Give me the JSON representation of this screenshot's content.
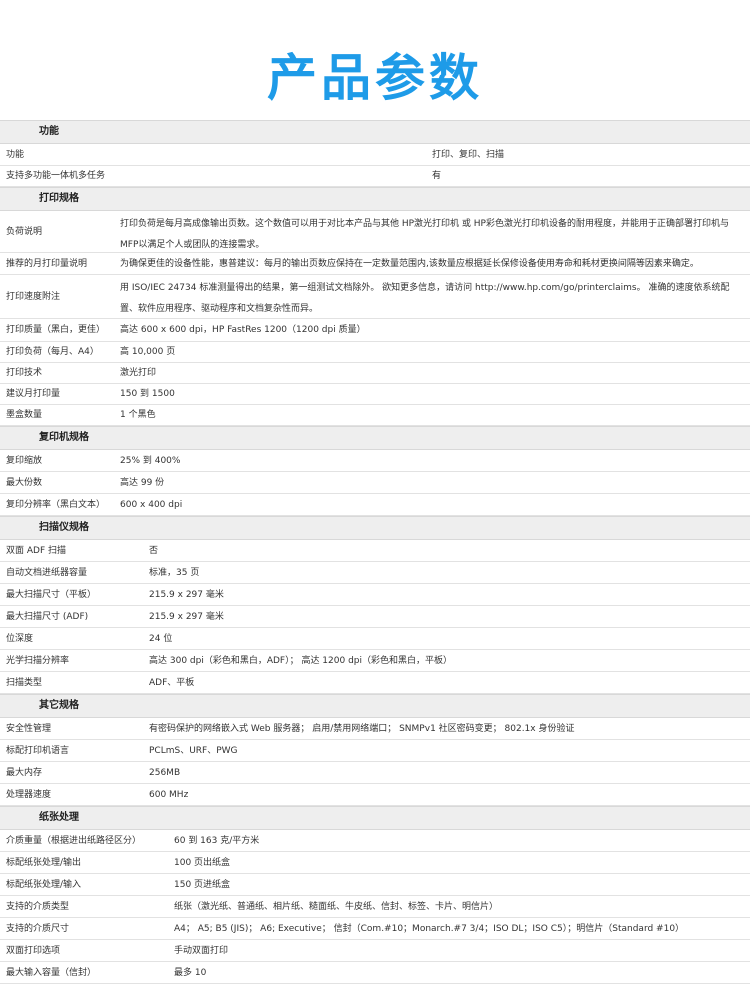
{
  "title": "产品参数",
  "sections": [
    {
      "heading": "功能",
      "rows": [
        {
          "label": "功能",
          "value": "打印、复印、扫描"
        },
        {
          "label": "支持多功能一体机多任务",
          "value": "有"
        }
      ]
    },
    {
      "heading": "打印规格",
      "rows": [
        {
          "label": "负荷说明",
          "value": "打印负荷是每月高成像输出页数。这个数值可以用于对比本产品与其他 HP激光打印机 或 HP彩色激光打印机设备的耐用程度，并能用于正确部署打印机与MFP以满足个人或团队的连接需求。"
        },
        {
          "label": "推荐的月打印量说明",
          "value": "为确保更佳的设备性能，惠普建议：每月的输出页数应保持在一定数量范围内,该数量应根据延长保修设备使用寿命和耗材更换间隔等因素来确定。"
        },
        {
          "label": "打印速度附注",
          "value": "用 ISO/IEC 24734 标准测量得出的结果，第一组测试文档除外。 欲知更多信息，请访问 http://www.hp.com/go/printerclaims。 准确的速度依系统配置、软件应用程序、驱动程序和文档复杂性而异。"
        },
        {
          "label": "打印质量（黑白，更佳）",
          "value": "高达 600 x 600 dpi，HP FastRes 1200（1200 dpi 质量）"
        },
        {
          "label": "打印负荷（每月、A4）",
          "value": "高 10,000 页"
        },
        {
          "label": "打印技术",
          "value": "激光打印"
        },
        {
          "label": "建议月打印量",
          "value": "150 到 1500"
        },
        {
          "label": "墨盒数量",
          "value": "1 个黑色"
        }
      ]
    },
    {
      "heading": "复印机规格",
      "rows": [
        {
          "label": "复印缩放",
          "value": "25% 到 400%"
        },
        {
          "label": "最大份数",
          "value": "高达 99 份"
        },
        {
          "label": "复印分辨率（黑白文本）",
          "value": "600 x 400 dpi"
        }
      ]
    },
    {
      "heading": "扫描仪规格",
      "rows": [
        {
          "label": "双面 ADF 扫描",
          "value": "否"
        },
        {
          "label": "自动文档进纸器容量",
          "value": "标准，35 页"
        },
        {
          "label": "最大扫描尺寸（平板）",
          "value": "215.9 x 297 毫米"
        },
        {
          "label": "最大扫描尺寸 (ADF)",
          "value": "215.9 x 297 毫米"
        },
        {
          "label": "位深度",
          "value": "24 位"
        },
        {
          "label": "光学扫描分辨率",
          "value": "高达 300 dpi（彩色和黑白，ADF）； 高达 1200 dpi（彩色和黑白，平板）"
        },
        {
          "label": "扫描类型",
          "value": "ADF、平板"
        }
      ]
    },
    {
      "heading": "其它规格",
      "rows": [
        {
          "label": "安全性管理",
          "value": "有密码保护的网络嵌入式 Web 服务器； 启用/禁用网络端口； SNMPv1 社区密码变更； 802.1x 身份验证"
        },
        {
          "label": "标配打印机语言",
          "value": "PCLmS、URF、PWG"
        },
        {
          "label": "最大内存",
          "value": "256MB"
        },
        {
          "label": "处理器速度",
          "value": "600 MHz"
        }
      ]
    },
    {
      "heading": "纸张处理",
      "rows": [
        {
          "label": "介质重量（根据进出纸路径区分）",
          "value": "60 到 163 克/平方米"
        },
        {
          "label": "标配纸张处理/输出",
          "value": "100 页出纸盒"
        },
        {
          "label": "标配纸张处理/输入",
          "value": "150 页进纸盒"
        },
        {
          "label": "支持的介质类型",
          "value": "纸张（激光纸、普通纸、相片纸、糙面纸、牛皮纸、信封、标签、卡片、明信片）"
        },
        {
          "label": "支持的介质尺寸",
          "value": "A4； A5; B5 (JIS)； A6; Executive； 信封（Com.#10；Monarch.#7 3/4；ISO DL；ISO C5）；明信片（Standard #10）"
        },
        {
          "label": "双面打印选项",
          "value": "手动双面打印"
        },
        {
          "label": "最大输入容量（信封）",
          "value": "最多 10"
        }
      ]
    }
  ]
}
